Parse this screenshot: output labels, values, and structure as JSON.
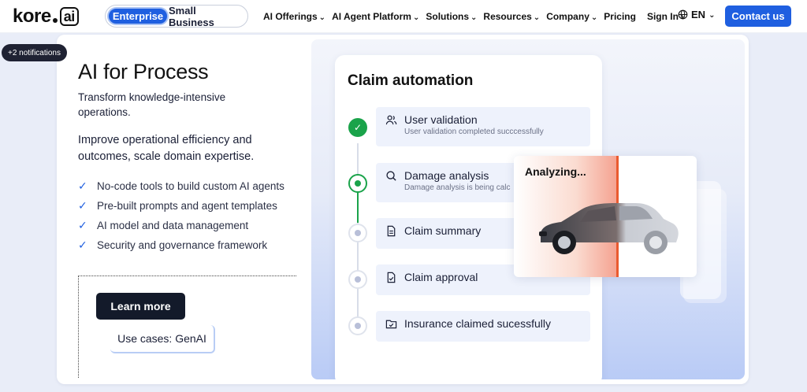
{
  "nav": {
    "logo_text": "kore",
    "logo_ai": "ai",
    "segment": {
      "active": "Enterprise",
      "inactive": "Small Business"
    },
    "items": [
      {
        "label": "AI Offerings",
        "chevron": "chevron-down"
      },
      {
        "label": "AI Agent Platform",
        "chevron": "chevron-down"
      },
      {
        "label": "Solutions",
        "chevron": "chevron-down"
      },
      {
        "label": "Resources",
        "chevron": "chevron-down"
      },
      {
        "label": "Company",
        "chevron": "chevron-down"
      },
      {
        "label": "Pricing",
        "chevron": ""
      },
      {
        "label": "Sign In",
        "chevron": "chevron-right"
      }
    ],
    "language": "EN",
    "contact": "Contact us"
  },
  "notification_badge": "+2 notifications",
  "hero": {
    "title": "AI for Process",
    "subtitle": "Transform knowledge-intensive operations.",
    "description": "Improve operational efficiency and outcomes, scale domain expertise.",
    "features": [
      "No-code tools to build custom AI agents",
      "Pre-built prompts and agent templates",
      "AI model and data management",
      "Security and governance framework"
    ],
    "learn_more": "Learn more",
    "use_cases": "Use cases: GenAI"
  },
  "flow": {
    "title": "Claim automation",
    "steps": [
      {
        "label": "User validation",
        "status_text": "User validation completed succcessfully",
        "state": "done",
        "icon": "users-icon"
      },
      {
        "label": "Damage analysis",
        "status_text": "Damage analysis is being calc",
        "state": "active",
        "icon": "search-icon"
      },
      {
        "label": "Claim summary",
        "status_text": "",
        "state": "pending",
        "icon": "document-icon"
      },
      {
        "label": "Claim approval",
        "status_text": "",
        "state": "pending",
        "icon": "document-check-icon"
      },
      {
        "label": "Insurance claimed sucessfully",
        "status_text": "",
        "state": "pending",
        "icon": "folder-check-icon"
      }
    ],
    "analyzing": "Analyzing..."
  },
  "colors": {
    "accent": "#1f5fe0",
    "success": "#1aa34a",
    "scan_line": "#ea5a2f",
    "dark_button": "#131a2a"
  }
}
